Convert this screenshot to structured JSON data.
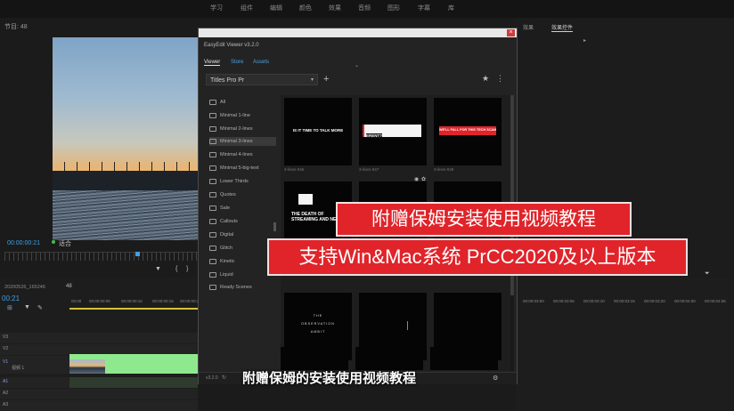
{
  "workspaces": [
    "学习",
    "组件",
    "编辑",
    "颜色",
    "效果",
    "音频",
    "图形",
    "字幕",
    "库"
  ],
  "program_panel": {
    "title": "节目: 48",
    "timecode": "00:00:00:21",
    "fit": "适合"
  },
  "timeline": {
    "sequence_name": "20200526_165246",
    "sequence_tab": "48",
    "timecode": "00:21",
    "ruler_labels": [
      "00:00",
      "00:00:00:05",
      "00:00:00:10",
      "00:00:00:15",
      "00:00:00:20",
      "00:00:01:00"
    ],
    "right_ruler_labels": [
      "00:00:03:00",
      "00:00:03:05",
      "00:00:03:10",
      "00:00:03:15",
      "00:00:03:20",
      "00:00:04:00",
      "00:00:04:05"
    ],
    "tracks": [
      "V3",
      "V2",
      "V1",
      "A1",
      "A2",
      "A3"
    ],
    "v1_label": "视频 1"
  },
  "right_panel": {
    "tabs": [
      "效果",
      "效果控件"
    ]
  },
  "easyedit": {
    "window_name": "EasyEdit Viewer v3.2.0",
    "tabs": [
      "Viewer",
      "Store",
      "Assets"
    ],
    "selected_pack": "Titles Pro Pr",
    "folders": [
      "All",
      "Minimal 1-line",
      "Minimal 2-lines",
      "Minimal 3-lines",
      "Minimal 4-lines",
      "Minimal 5-big-text",
      "Lower Thirds",
      "Quotes",
      "Sale",
      "Callouts",
      "Digital",
      "Glitch",
      "Kinetic",
      "Liquid",
      "Ready Scenes"
    ],
    "active_folder": 3,
    "thumbnails": [
      {
        "caption": "3-lines-046",
        "text": "IS IT TIME TO TALK MORE"
      },
      {
        "caption": "3-lines-047",
        "text": "ERENT?"
      },
      {
        "caption": "3-lines-048",
        "text": "WE'LL FALL FOR THIS TECH SCAM"
      },
      {
        "caption": "3-lines-049",
        "text": "THE DEATH OF STREAMING AND NEW"
      },
      {
        "caption": "3-lines-050",
        "text": ""
      },
      {
        "caption": "3-lines-051",
        "text": ""
      },
      {
        "caption": "3-lines-052",
        "text": "THE OBSERVATION AMBIT"
      },
      {
        "caption": "3-lines-053",
        "text": ""
      },
      {
        "caption": "3-lines-054",
        "text": ""
      }
    ],
    "version": "v3.2.0"
  },
  "overlays": {
    "banner1": "附赠保姆安装使用视频教程",
    "banner2": "支持Win&Mac系统  PrCC2020及以上版本",
    "subtitle": "附赠保姆的安装使用视频教程"
  },
  "colors": {
    "accent_red": "#e0242a",
    "clip_green": "#8ee88e",
    "timecode_blue": "#3ea0e6"
  }
}
